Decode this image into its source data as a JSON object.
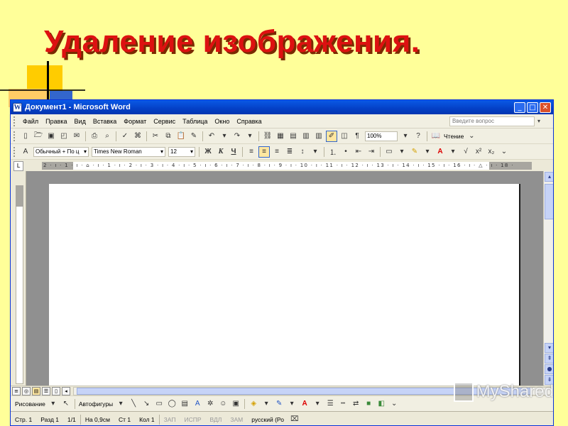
{
  "slide": {
    "title": "Удаление изображения.",
    "watermark": "MyShared"
  },
  "window": {
    "title": "Документ1 - Microsoft Word",
    "buttons": [
      "_",
      "□",
      "✕"
    ]
  },
  "menubar": {
    "items": [
      "Файл",
      "Правка",
      "Вид",
      "Вставка",
      "Формат",
      "Сервис",
      "Таблица",
      "Окно",
      "Справка"
    ],
    "ask_placeholder": "Введите вопрос"
  },
  "standard_toolbar": {
    "zoom": "100%",
    "reading_label": "Чтение"
  },
  "formatting_toolbar": {
    "style": "Обычный + По ц",
    "font": "Times New Roman",
    "size": "12",
    "bold": "Ж",
    "italic": "К",
    "underline": "Ч"
  },
  "ruler": {
    "ticks": "2 · ı · 1 · ı · ⌂ · ı · 1 · ı · 2 · ı · 3 · ı · 4 · ı · 5 · ı · 6 · ı · 7 · ı · 8 · ı · 9 · ı · 10 · ı · 11 · ı · 12 · ı · 13 · ı · 14 · ı · 15 · ı · 16 · ı · △ · ı · 18 ·"
  },
  "drawing_toolbar": {
    "draw_label": "Рисование",
    "autoshapes_label": "Автофигуры"
  },
  "statusbar": {
    "page": "Стр. 1",
    "section": "Разд 1",
    "pages": "1/1",
    "at": "На 0,9см",
    "line": "Ст 1",
    "col": "Кол 1",
    "rec": "ЗАП",
    "trk": "ИСПР",
    "ext": "ВДЛ",
    "ovr": "ЗАМ",
    "language": "русский (Ро"
  },
  "colors": {
    "background": "#ffff99",
    "title_red": "#dd1111",
    "titlebar_blue": "#0440c6"
  }
}
